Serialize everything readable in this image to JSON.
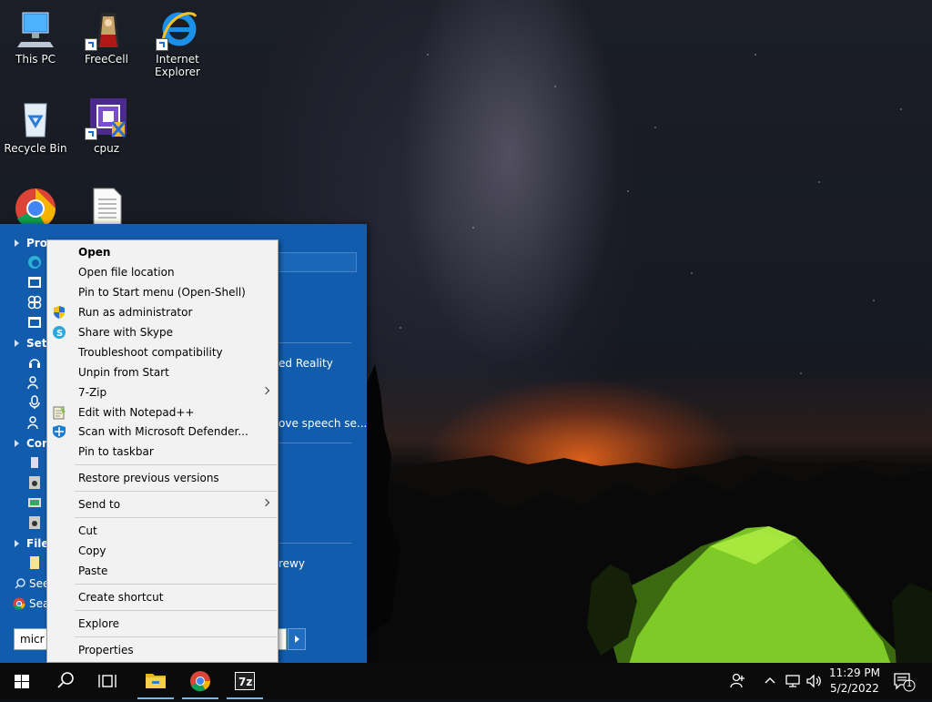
{
  "desktop": {
    "icons": [
      {
        "label_line1": "This PC",
        "label_line2": ""
      },
      {
        "label_line1": "FreeCell",
        "label_line2": ""
      },
      {
        "label_line1": "Internet",
        "label_line2": "Explorer"
      },
      {
        "label_line1": "Recycle Bin",
        "label_line2": ""
      },
      {
        "label_line1": "cpuz",
        "label_line2": ""
      },
      {
        "label_line1": "",
        "label_line2": ""
      },
      {
        "label_line1": "",
        "label_line2": ""
      }
    ]
  },
  "start_menu": {
    "groups": [
      {
        "label": "Pro"
      },
      {
        "label": "Set"
      },
      {
        "label": "Con"
      },
      {
        "label": "Files"
      },
      {
        "label": "See"
      },
      {
        "label": "Sea"
      }
    ],
    "visible_results": [
      {
        "text": "ed Reality"
      },
      {
        "text": "ove speech se..."
      },
      {
        "text": "rewy"
      }
    ],
    "search_value": "micr"
  },
  "context_menu": {
    "items": [
      {
        "label": "Open",
        "icon": "",
        "bold": true,
        "submenu": false
      },
      {
        "label": "Open file location",
        "icon": ""
      },
      {
        "label": "Pin to Start menu (Open-Shell)",
        "icon": ""
      },
      {
        "label": "Run as administrator",
        "icon": "uac-shield-icon"
      },
      {
        "label": "Share with Skype",
        "icon": "skype-icon"
      },
      {
        "label": "Troubleshoot compatibility",
        "icon": ""
      },
      {
        "label": "Unpin from Start",
        "icon": ""
      },
      {
        "label": "7-Zip",
        "icon": "",
        "submenu": true
      },
      {
        "label": "Edit with Notepad++",
        "icon": "notepad-plus-plus-icon"
      },
      {
        "label": "Scan with Microsoft Defender...",
        "icon": "defender-icon"
      },
      {
        "label": "Pin to taskbar",
        "icon": ""
      },
      {
        "label": "Restore previous versions",
        "icon": ""
      },
      {
        "label": "Send to",
        "icon": "",
        "submenu": true
      },
      {
        "label": "Cut",
        "icon": ""
      },
      {
        "label": "Copy",
        "icon": ""
      },
      {
        "label": "Paste",
        "icon": ""
      },
      {
        "label": "Create shortcut",
        "icon": ""
      },
      {
        "label": "Explore",
        "icon": ""
      },
      {
        "label": "Properties",
        "icon": ""
      }
    ]
  },
  "taskbar": {
    "buttons": [
      "start-icon",
      "search-icon",
      "task-view-icon",
      "file-explorer-icon",
      "chrome-icon",
      "7zip-icon"
    ],
    "clock": {
      "time": "11:29 PM",
      "date": "5/2/2022"
    },
    "notification_count": "1",
    "seven_zip_text": "7z"
  }
}
